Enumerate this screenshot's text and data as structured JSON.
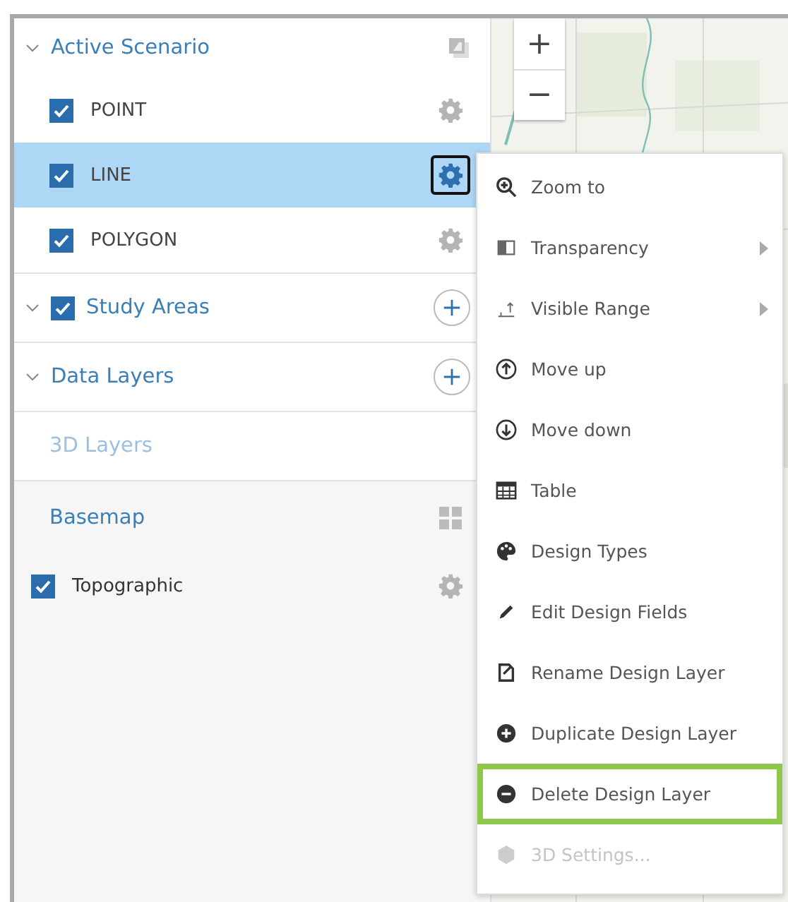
{
  "layers": {
    "sections": [
      {
        "kind": "scenario",
        "title": "Active Scenario",
        "expanded": true,
        "layers": [
          {
            "name": "POINT",
            "checked": true,
            "selected": false
          },
          {
            "name": "LINE",
            "checked": true,
            "selected": true
          },
          {
            "name": "POLYGON",
            "checked": true,
            "selected": false
          }
        ]
      },
      {
        "kind": "checkable",
        "title": "Study Areas",
        "expanded": true,
        "checked": true
      },
      {
        "kind": "group",
        "title": "Data Layers",
        "expanded": true
      },
      {
        "kind": "faded",
        "title": "3D Layers"
      }
    ]
  },
  "basemap": {
    "title": "Basemap",
    "layers": [
      {
        "name": "Topographic",
        "checked": true
      }
    ]
  },
  "map": {
    "zoom_in": "+",
    "zoom_out": "−"
  },
  "context_menu": {
    "items": [
      {
        "label": "Zoom to",
        "submenu": false,
        "highlighted": false,
        "disabled": false
      },
      {
        "label": "Transparency",
        "submenu": true,
        "highlighted": false,
        "disabled": false
      },
      {
        "label": "Visible Range",
        "submenu": true,
        "highlighted": false,
        "disabled": false
      },
      {
        "label": "Move up",
        "submenu": false,
        "highlighted": false,
        "disabled": false
      },
      {
        "label": "Move down",
        "submenu": false,
        "highlighted": false,
        "disabled": false
      },
      {
        "label": "Table",
        "submenu": false,
        "highlighted": false,
        "disabled": false
      },
      {
        "label": "Design Types",
        "submenu": false,
        "highlighted": false,
        "disabled": false
      },
      {
        "label": "Edit Design Fields",
        "submenu": false,
        "highlighted": false,
        "disabled": false
      },
      {
        "label": "Rename Design Layer",
        "submenu": false,
        "highlighted": false,
        "disabled": false
      },
      {
        "label": "Duplicate Design Layer",
        "submenu": false,
        "highlighted": false,
        "disabled": false
      },
      {
        "label": "Delete Design Layer",
        "submenu": false,
        "highlighted": true,
        "disabled": false
      },
      {
        "label": "3D Settings...",
        "submenu": false,
        "highlighted": false,
        "disabled": true
      }
    ]
  }
}
